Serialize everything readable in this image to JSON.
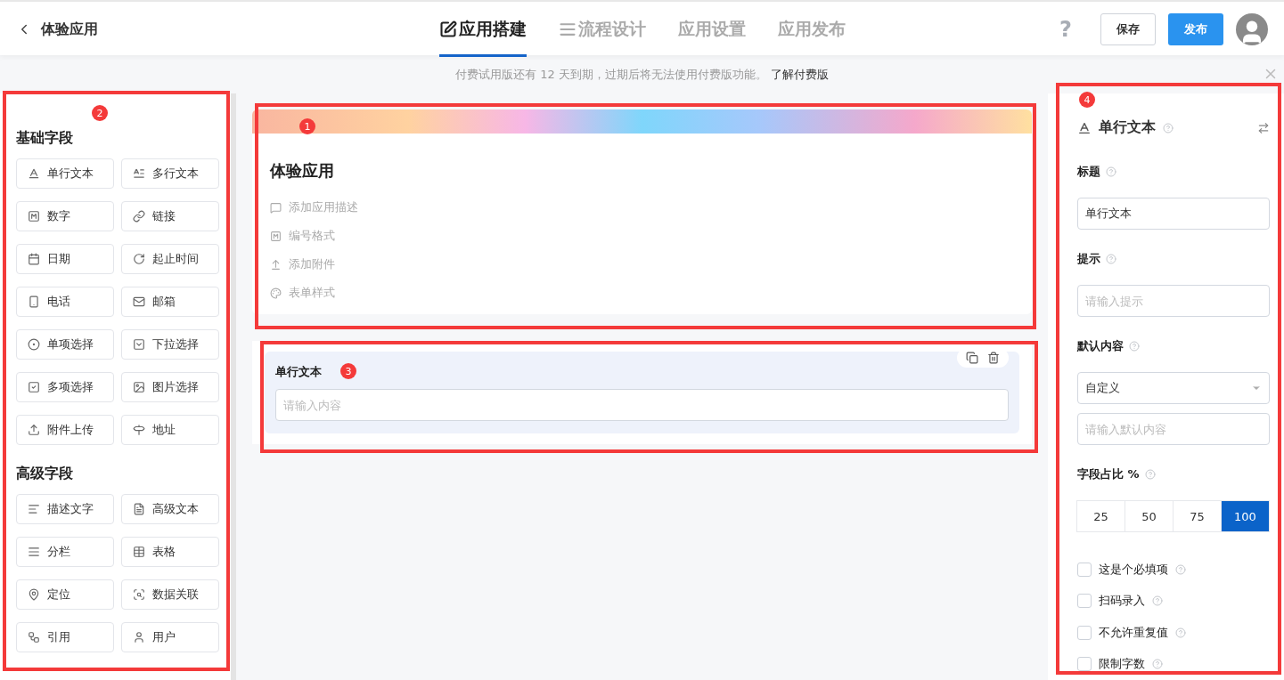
{
  "header": {
    "back_label": "体验应用",
    "tabs": [
      {
        "label": "应用搭建",
        "selected": true
      },
      {
        "label": "流程设计",
        "selected": false
      },
      {
        "label": "应用设置",
        "selected": false
      },
      {
        "label": "应用发布",
        "selected": false
      }
    ],
    "help": "?",
    "save": "保存",
    "publish": "发布"
  },
  "notice": {
    "text": "付费试用版还有 12 天到期，过期后将无法使用付费版功能。",
    "link": "了解付费版"
  },
  "palette": {
    "groups": [
      {
        "title": "基础字段",
        "items": [
          "单行文本",
          "多行文本",
          "数字",
          "链接",
          "日期",
          "起止时间",
          "电话",
          "邮箱",
          "单项选择",
          "下拉选择",
          "多项选择",
          "图片选择",
          "附件上传",
          "地址"
        ]
      },
      {
        "title": "高级字段",
        "items": [
          "描述文字",
          "高级文本",
          "分栏",
          "表格",
          "定位",
          "数据关联",
          "引用",
          "用户"
        ]
      }
    ]
  },
  "form": {
    "title": "体验应用",
    "actions": [
      "添加应用描述",
      "编号格式",
      "添加附件",
      "表单样式"
    ],
    "field": {
      "label": "单行文本",
      "placeholder": "请输入内容"
    }
  },
  "properties": {
    "title": "单行文本",
    "title_field": {
      "label": "标题",
      "value": "单行文本"
    },
    "hint_field": {
      "label": "提示",
      "placeholder": "请输入提示"
    },
    "default_field": {
      "label": "默认内容",
      "select": "自定义",
      "placeholder": "请输入默认内容"
    },
    "ratio": {
      "label": "字段占比 %",
      "options": [
        {
          "label": "25",
          "selected": false
        },
        {
          "label": "50",
          "selected": false
        },
        {
          "label": "75",
          "selected": false
        },
        {
          "label": "100",
          "selected": true
        }
      ]
    },
    "options": [
      {
        "label": "这是个必填项",
        "checked": false
      },
      {
        "label": "扫码录入",
        "checked": false
      },
      {
        "label": "不允许重复值",
        "checked": false
      },
      {
        "label": "限制字数",
        "checked": false
      }
    ]
  },
  "annotations": [
    {
      "number": "1"
    },
    {
      "number": "2"
    },
    {
      "number": "3"
    },
    {
      "number": "4"
    }
  ]
}
